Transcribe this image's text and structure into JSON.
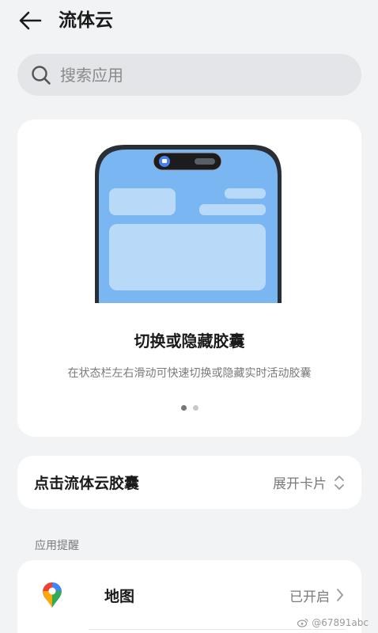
{
  "header": {
    "title": "流体云",
    "back_icon": "arrow-left-icon"
  },
  "search": {
    "placeholder": "搜索应用",
    "value": "",
    "icon": "search-icon"
  },
  "feature_card": {
    "title": "切换或隐藏胶囊",
    "description": "在状态栏左右滑动可快速切换或隐藏实时活动胶囊",
    "page_count": 2,
    "active_page": 1,
    "illustration_colors": {
      "screen": "#7ab6f2",
      "frame": "#2a2f36",
      "block": "#b9d9f8",
      "capsule": "#1c1c1e",
      "capsule_dot": "#4a80e8"
    }
  },
  "capsule_setting": {
    "label": "点击流体云胶囊",
    "value": "展开卡片"
  },
  "section": {
    "label": "应用提醒"
  },
  "apps": [
    {
      "name": "地图",
      "status": "已开启",
      "icon": "map-pin-icon"
    }
  ],
  "watermark": {
    "text": "@6789​1abc"
  }
}
